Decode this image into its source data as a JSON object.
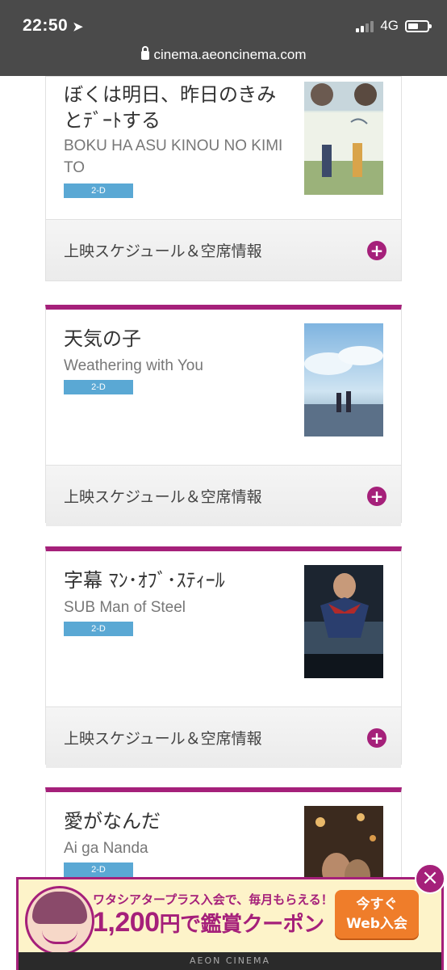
{
  "status_bar": {
    "time": "22:50",
    "network": "4G"
  },
  "browser": {
    "url": "cinema.aeoncinema.com"
  },
  "schedule_label": "上映スケジュール＆空席情報",
  "movies": [
    {
      "title_jp": "ぼくは明日、昨日のきみとﾃﾞｰﾄする",
      "title_en": "BOKU HA ASU KINOU NO KIMI TO",
      "format": "2-D"
    },
    {
      "title_jp": "天気の子",
      "title_en": "Weathering with You",
      "format": "2-D"
    },
    {
      "title_jp": "字幕 ﾏﾝ･ｵﾌﾞ･ｽﾃｨｰﾙ",
      "title_en": "SUB Man of Steel",
      "format": "2-D"
    },
    {
      "title_jp": "愛がなんだ",
      "title_en": "Ai ga Nanda",
      "format": "2-D"
    }
  ],
  "banner": {
    "subtitle": "ワタシアタープラス入会で、毎月もらえる！",
    "amount": "1,200",
    "amount_suffix": "円で",
    "coupon": "鑑賞クーポン",
    "cta_line1": "今すぐ",
    "cta_line2": "Web入会",
    "footer": "AEON CINEMA"
  },
  "colors": {
    "accent": "#a5207a",
    "badge": "#5aa8d4",
    "cta": "#ef7d2a"
  }
}
